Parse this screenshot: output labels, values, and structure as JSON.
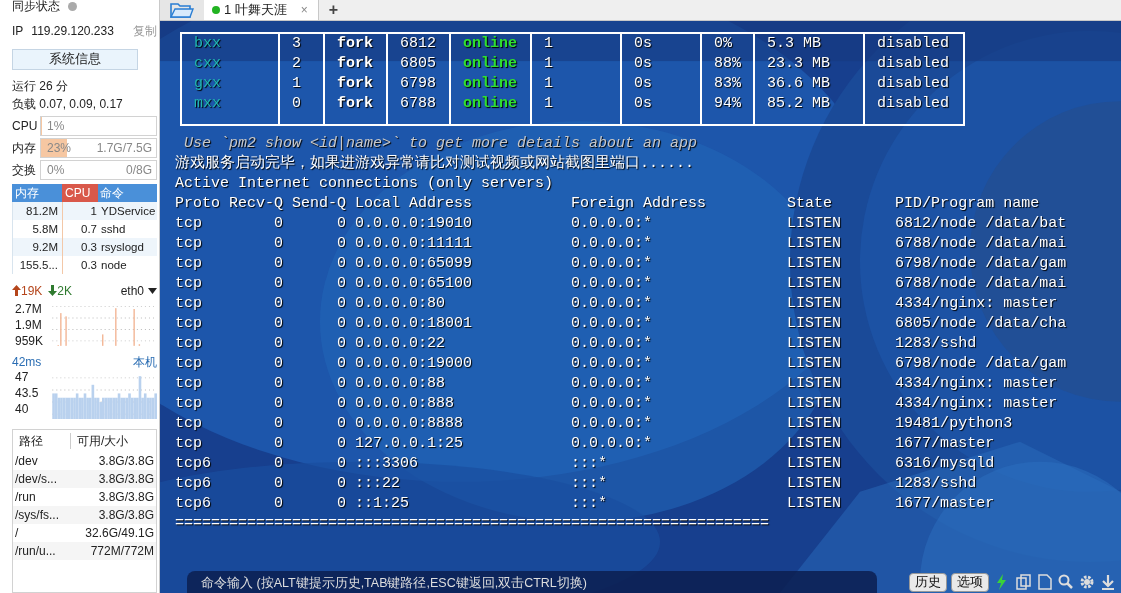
{
  "sidebar": {
    "sync": {
      "label": "同步状态",
      "connected": false
    },
    "ip": {
      "label": "IP",
      "value": "119.29.120.233",
      "copy": "复制"
    },
    "info_button": "系统信息",
    "uptime": "运行 26 分",
    "load": "负载 0.07, 0.09, 0.17",
    "meters": [
      {
        "label": "CPU",
        "value": "1%",
        "level": 0.01
      },
      {
        "label": "内存",
        "value": "23%",
        "detail": "1.7G/7.5G",
        "level": 0.23
      },
      {
        "label": "交换",
        "value": "0%",
        "detail": "0/8G",
        "level": 0
      }
    ],
    "processes": {
      "columns": [
        {
          "label": "内存",
          "sorted": false
        },
        {
          "label": "CPU",
          "sorted": true
        },
        {
          "label": "命令",
          "sorted": false
        }
      ],
      "rows": [
        [
          "81.2M",
          "1",
          "YDService"
        ],
        [
          "5.8M",
          "0.7",
          "sshd"
        ],
        [
          "9.2M",
          "0.3",
          "rsyslogd"
        ],
        [
          "155.5...",
          "0.3",
          "node"
        ]
      ]
    },
    "network": {
      "up": "19K",
      "down": "2K",
      "interface": "eth0",
      "ticks": [
        "2.7M",
        "1.9M",
        "959K"
      ]
    },
    "ping": {
      "latency": "42ms",
      "target": "本机",
      "ticks": [
        "47",
        "43.5",
        "40"
      ]
    },
    "disks": {
      "columns": [
        "路径",
        "可用/大小"
      ],
      "rows": [
        {
          "path": "/dev",
          "size": "3.8G/3.8G"
        },
        {
          "path": "/dev/s...",
          "size": "3.8G/3.8G"
        },
        {
          "path": "/run",
          "size": "3.8G/3.8G"
        },
        {
          "path": "/sys/fs...",
          "size": "3.8G/3.8G"
        },
        {
          "path": "/",
          "size": "32.6G/49.1G"
        },
        {
          "path": "/run/u...",
          "size": "772M/772M"
        }
      ]
    }
  },
  "tabs": [
    {
      "label": "1 叶舞天涯",
      "selected": true,
      "connected": true,
      "close": "×"
    }
  ],
  "new_tab": "+",
  "terminal": {
    "pm2_table": [
      {
        "name": "bxx",
        "id": "3",
        "mode": "fork",
        "pid": "6812",
        "status": "online",
        "restart": "1",
        "uptime": "0s",
        "cpu": "0%",
        "mem": "5.3 MB",
        "watching": "disabled"
      },
      {
        "name": "cxx",
        "id": "2",
        "mode": "fork",
        "pid": "6805",
        "status": "online",
        "restart": "1",
        "uptime": "0s",
        "cpu": "88%",
        "mem": "23.3 MB",
        "watching": "disabled"
      },
      {
        "name": "gxx",
        "id": "1",
        "mode": "fork",
        "pid": "6798",
        "status": "online",
        "restart": "1",
        "uptime": "0s",
        "cpu": "83%",
        "mem": "36.6 MB",
        "watching": "disabled"
      },
      {
        "name": "mxx",
        "id": "0",
        "mode": "fork",
        "pid": "6788",
        "status": "online",
        "restart": "1",
        "uptime": "0s",
        "cpu": "94%",
        "mem": "85.2 MB",
        "watching": "disabled"
      }
    ],
    "hint": "Use `pm2 show <id|name>` to get more details about an app",
    "lines": [
      "游戏服务启动完毕，如果进游戏异常请比对测试视频或网站截图里端口......",
      "Active Internet connections (only servers)",
      "Proto Recv-Q Send-Q Local Address           Foreign Address         State       PID/Program name",
      "tcp        0      0 0.0.0.0:19010           0.0.0.0:*               LISTEN      6812/node /data/bat",
      "tcp        0      0 0.0.0.0:11111           0.0.0.0:*               LISTEN      6788/node /data/mai",
      "tcp        0      0 0.0.0.0:65099           0.0.0.0:*               LISTEN      6798/node /data/gam",
      "tcp        0      0 0.0.0.0:65100           0.0.0.0:*               LISTEN      6788/node /data/mai",
      "tcp        0      0 0.0.0.0:80              0.0.0.0:*               LISTEN      4334/nginx: master",
      "tcp        0      0 0.0.0.0:18001           0.0.0.0:*               LISTEN      6805/node /data/cha",
      "tcp        0      0 0.0.0.0:22              0.0.0.0:*               LISTEN      1283/sshd",
      "tcp        0      0 0.0.0.0:19000           0.0.0.0:*               LISTEN      6798/node /data/gam",
      "tcp        0      0 0.0.0.0:88              0.0.0.0:*               LISTEN      4334/nginx: master",
      "tcp        0      0 0.0.0.0:888             0.0.0.0:*               LISTEN      4334/nginx: master",
      "tcp        0      0 0.0.0.0:8888            0.0.0.0:*               LISTEN      19481/python3",
      "tcp        0      0 127.0.0.1:25            0.0.0.0:*               LISTEN      1677/master",
      "tcp6       0      0 :::3306                 :::*                    LISTEN      6316/mysqld",
      "tcp6       0      0 :::22                   :::*                    LISTEN      1283/sshd",
      "tcp6       0      0 ::1:25                  :::*                    LISTEN      1677/master",
      "=================================================================="
    ]
  },
  "command_bar": {
    "placeholder": "命令输入 (按ALT键提示历史,TAB键路径,ESC键返回,双击CTRL切换)",
    "buttons": [
      "历史",
      "选项"
    ]
  }
}
